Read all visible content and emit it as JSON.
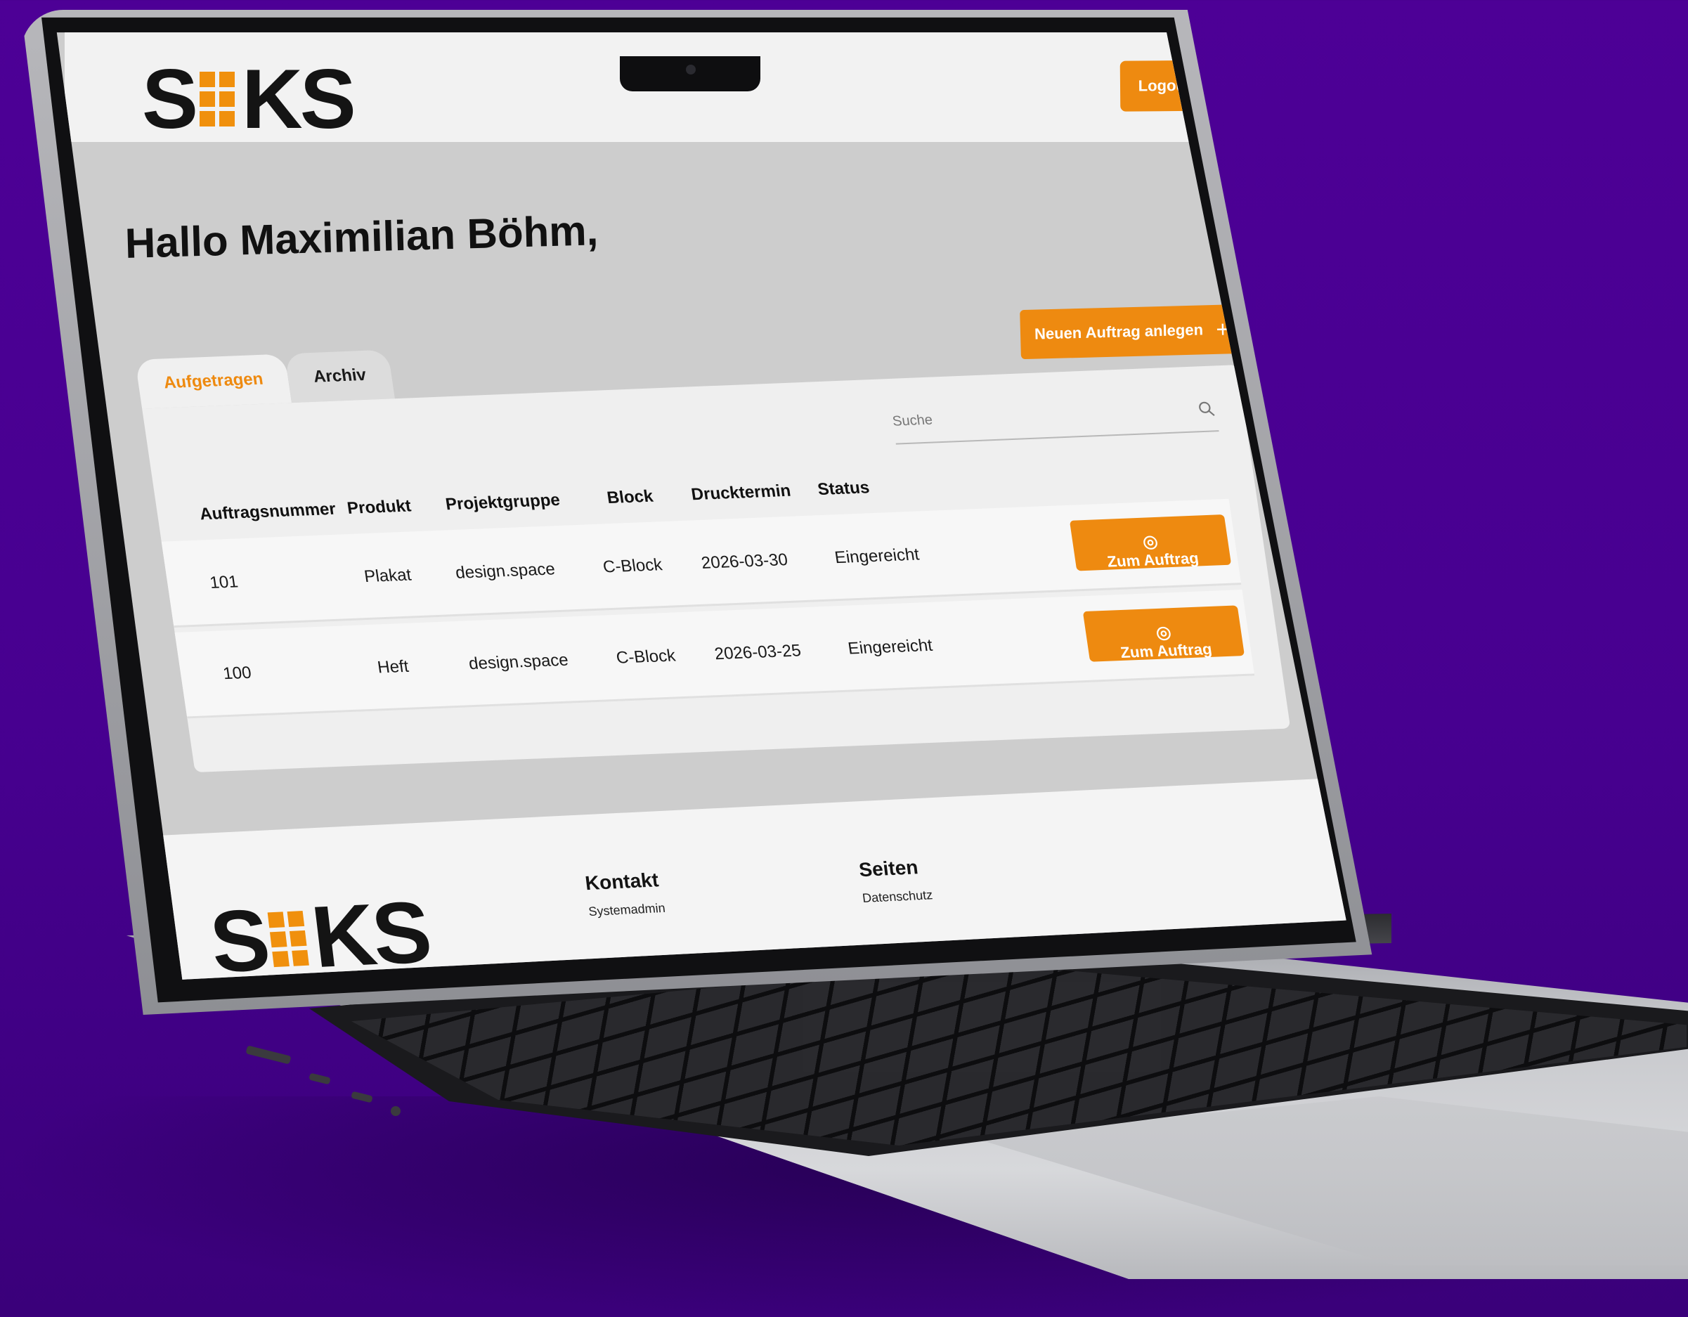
{
  "header": {
    "logo_text_left": "S",
    "logo_text_right": "KS",
    "logout_label": "Logout"
  },
  "main": {
    "greeting": "Hallo Maximilian Böhm,",
    "new_order_label": "Neuen Auftrag anlegen",
    "tabs": [
      {
        "label": "Aufgetragen",
        "active": true
      },
      {
        "label": "Archiv",
        "active": false
      }
    ],
    "search": {
      "placeholder": "Suche"
    },
    "table": {
      "columns": [
        "Auftragsnummer",
        "Produkt",
        "Projektgruppe",
        "Block",
        "Drucktermin",
        "Status"
      ],
      "rows": [
        {
          "number": "101",
          "product": "Plakat",
          "group": "design.space",
          "block": "C-Block",
          "date": "2026-03-30",
          "status": "Eingereicht",
          "action": "Zum Auftrag"
        },
        {
          "number": "100",
          "product": "Heft",
          "group": "design.space",
          "block": "C-Block",
          "date": "2026-03-25",
          "status": "Eingereicht",
          "action": "Zum Auftrag"
        }
      ]
    }
  },
  "footer": {
    "logo_text_left": "S",
    "logo_text_right": "KS",
    "contact_title": "Kontakt",
    "contact_link": "Systemadmin",
    "pages_title": "Seiten",
    "pages_link": "Datenschutz"
  },
  "colors": {
    "accent": "#ee8a10",
    "background": "#4d0096",
    "text": "#111111"
  },
  "icons": [
    "logout-icon",
    "plus-icon",
    "search-icon",
    "eye-icon"
  ]
}
